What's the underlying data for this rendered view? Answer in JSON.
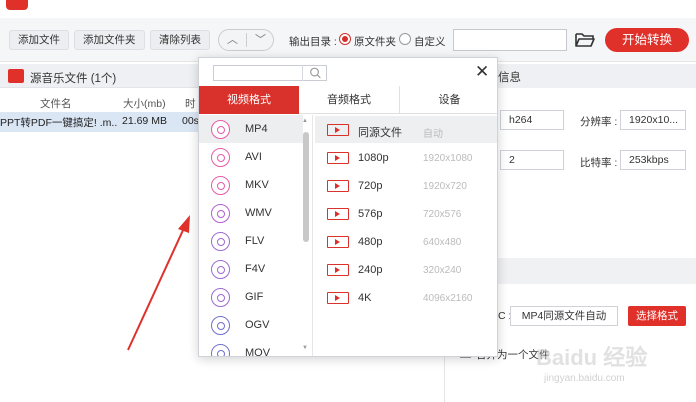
{
  "toolbar": {
    "add_file": "添加文件",
    "add_folder": "添加文件夹",
    "clear_list": "清除列表",
    "output_dir_label": "输出目录 :",
    "radio_source": "原文件夹",
    "radio_custom": "自定义",
    "output_path_value": "",
    "start_button": "开始转换"
  },
  "source": {
    "title": "源音乐文件 (1个)",
    "columns": [
      "文件名",
      "大小(mb)",
      "时"
    ],
    "file": {
      "name": "PPT转PDF一键搞定! .m...",
      "size": "21.69 MB",
      "duration": "00s"
    }
  },
  "info": {
    "title": "信息",
    "codec": "h264",
    "resolution_label": "分辨率 :",
    "resolution": "1920x10...",
    "channels": "2",
    "bitrate_label": "比特率 :",
    "bitrate": "253kbps",
    "format_label_partial": "C :",
    "format_value": "MP4同源文件自动",
    "select_format": "选择格式",
    "merge_label_partial": "合并为一个文件"
  },
  "popup": {
    "search_value": "",
    "tabs": [
      "视频格式",
      "音频格式",
      "设备"
    ],
    "formats": [
      "MP4",
      "AVI",
      "MKV",
      "WMV",
      "FLV",
      "F4V",
      "GIF",
      "OGV",
      "MOV"
    ],
    "selected_format": "MP4",
    "resolutions": [
      {
        "name": "同源文件",
        "dim": "自动"
      },
      {
        "name": "1080p",
        "dim": "1920x1080"
      },
      {
        "name": "720p",
        "dim": "1920x720"
      },
      {
        "name": "576p",
        "dim": "720x576"
      },
      {
        "name": "480p",
        "dim": "640x480"
      },
      {
        "name": "240p",
        "dim": "320x240"
      },
      {
        "name": "4K",
        "dim": "4096x2160"
      }
    ]
  },
  "watermark": {
    "main": "Baidu 经验",
    "sub": "jingyan.baidu.com"
  },
  "colors": {
    "accent": "#d9312b",
    "selection": "#dbe6f5"
  }
}
